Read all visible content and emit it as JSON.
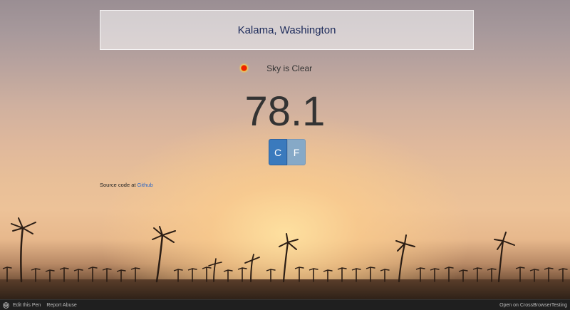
{
  "location": "Kalama, Washington",
  "condition": {
    "icon": "clear-sky-icon",
    "text": "Sky is Clear"
  },
  "temperature": "78.1",
  "units": {
    "celsius": "C",
    "fahrenheit": "F"
  },
  "source": {
    "prefix": "Source code at",
    "link_text": "Github"
  },
  "bottombar": {
    "edit": "Edit this Pen",
    "report": "Report Abuse",
    "open": "Open on CrossBrowserTesting"
  },
  "colors": {
    "title_text": "#1c2a5a",
    "button_c": "#3a7abd",
    "button_f": "#86a9c7",
    "link": "#2e67c4"
  }
}
